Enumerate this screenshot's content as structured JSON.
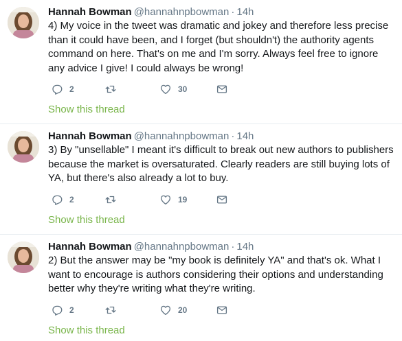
{
  "tweets": [
    {
      "name": "Hannah Bowman",
      "handle": "@hannahnpbowman",
      "separator": "·",
      "time": "14h",
      "text": "4) My voice in the tweet was dramatic and jokey and therefore less precise than it could have been, and I forget (but shouldn't) the authority agents command on here. That's on me and I'm sorry. Always feel free to ignore any advice I give! I could always be wrong!",
      "replies": "2",
      "retweets": "",
      "likes": "30",
      "show_thread": "Show this thread"
    },
    {
      "name": "Hannah Bowman",
      "handle": "@hannahnpbowman",
      "separator": "·",
      "time": "14h",
      "text": "3) By \"unsellable\" I meant it's difficult to break out new authors to publishers because the market is oversaturated. Clearly readers are still buying lots of YA, but there's also already a lot to buy.",
      "replies": "2",
      "retweets": "",
      "likes": "19",
      "show_thread": "Show this thread"
    },
    {
      "name": "Hannah Bowman",
      "handle": "@hannahnpbowman",
      "separator": "·",
      "time": "14h",
      "text": "2) But the answer may be \"my book is definitely YA\" and that's ok. What I want to encourage is authors considering their options and understanding better why they're writing what they're writing.",
      "replies": "2",
      "retweets": "",
      "likes": "20",
      "show_thread": "Show this thread"
    }
  ],
  "icons": {
    "reply": "reply-icon",
    "retweet": "retweet-icon",
    "like": "heart-icon",
    "dm": "envelope-icon"
  },
  "colors": {
    "text": "#14171a",
    "secondary": "#657786",
    "show_thread": "#79b54a",
    "divider": "#e6ecf0"
  }
}
